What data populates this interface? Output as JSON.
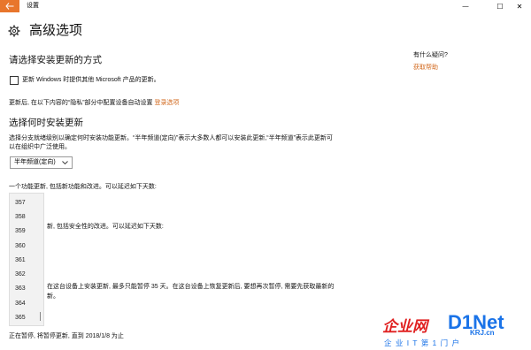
{
  "window": {
    "title": "设置",
    "controls": {
      "minimize": "—",
      "maximize": "☐",
      "close": "✕"
    }
  },
  "header": {
    "title": "高级选项"
  },
  "sidebar_help": {
    "question": "有什么疑问?",
    "link": "获取帮助"
  },
  "section_install": {
    "heading": "请选择安装更新的方式",
    "checkbox_label": "更新 Windows 时提供其他 Microsoft 产品的更新。",
    "checked": false,
    "restart_note": "更新后, 在以下内容的“隐私”部分中配置设备自动设置",
    "login_link": "登录选项"
  },
  "section_when": {
    "heading": "选择何时安装更新",
    "desc_line1": "选择分支就绪级别以确定何时安装功能更新。“半年频道(定向)”表示大多数人都可以安装此更新,“半年频道”表示此更新可",
    "desc_line2": "以在组织中广泛使用。",
    "branch_select": "半年频道(定向)"
  },
  "feature_defer": {
    "text": "一个功能更新, 包括新功能和改进。可以延迟如下天数:"
  },
  "quality_defer": {
    "text": "新, 包括安全性的改进。可以延迟如下天数:"
  },
  "pause": {
    "text": "在这台设备上安装更新, 最多只能暂停 35 天。在这台设备上恢复更新后, 要想再次暂停, 需要先获取最新的",
    "text2": "新。",
    "status": "正在暂停, 将暂停更新, 直到 2018/1/8 为止"
  },
  "dropdown_options": [
    "357",
    "358",
    "359",
    "360",
    "361",
    "362",
    "363",
    "364",
    "365"
  ],
  "watermark": {
    "brand": "企业网",
    "brand2": "D1Net",
    "sub": "企 业 I T 第 1 门 户",
    "url": "KRJ.cn"
  },
  "colors": {
    "accent": "#e8762c",
    "link": "#d2691e",
    "watermark_red": "#e02020",
    "watermark_blue": "#1a73e8"
  }
}
